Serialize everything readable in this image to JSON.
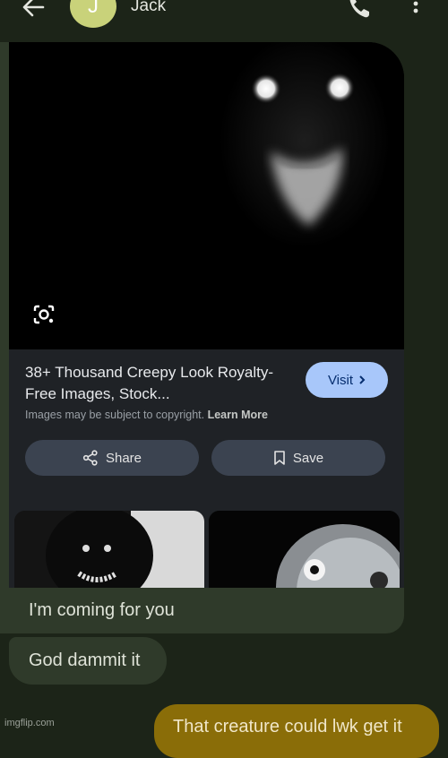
{
  "header": {
    "contact_name": "Jack",
    "avatar_letter": "J",
    "avatar_color": "#c9d27a"
  },
  "shared_result": {
    "title": "38+ Thousand Creepy Look Royalty-Free Images, Stock...",
    "visit_label": "Visit",
    "copyright_notice": "Images may be subject to copyright.",
    "learn_more_label": "Learn More",
    "share_label": "Share",
    "save_label": "Save"
  },
  "messages": [
    {
      "direction": "received",
      "text": "I'm coming for you"
    },
    {
      "direction": "received",
      "text": "God dammit it"
    },
    {
      "direction": "sent",
      "text": "That creature could lwk get it"
    }
  ],
  "watermark": "imgflip.com",
  "colors": {
    "background": "#1c2418",
    "received_bubble": "#2f3a2a",
    "sent_bubble": "#8a6d08",
    "visit_button": "#a8c7fa"
  }
}
